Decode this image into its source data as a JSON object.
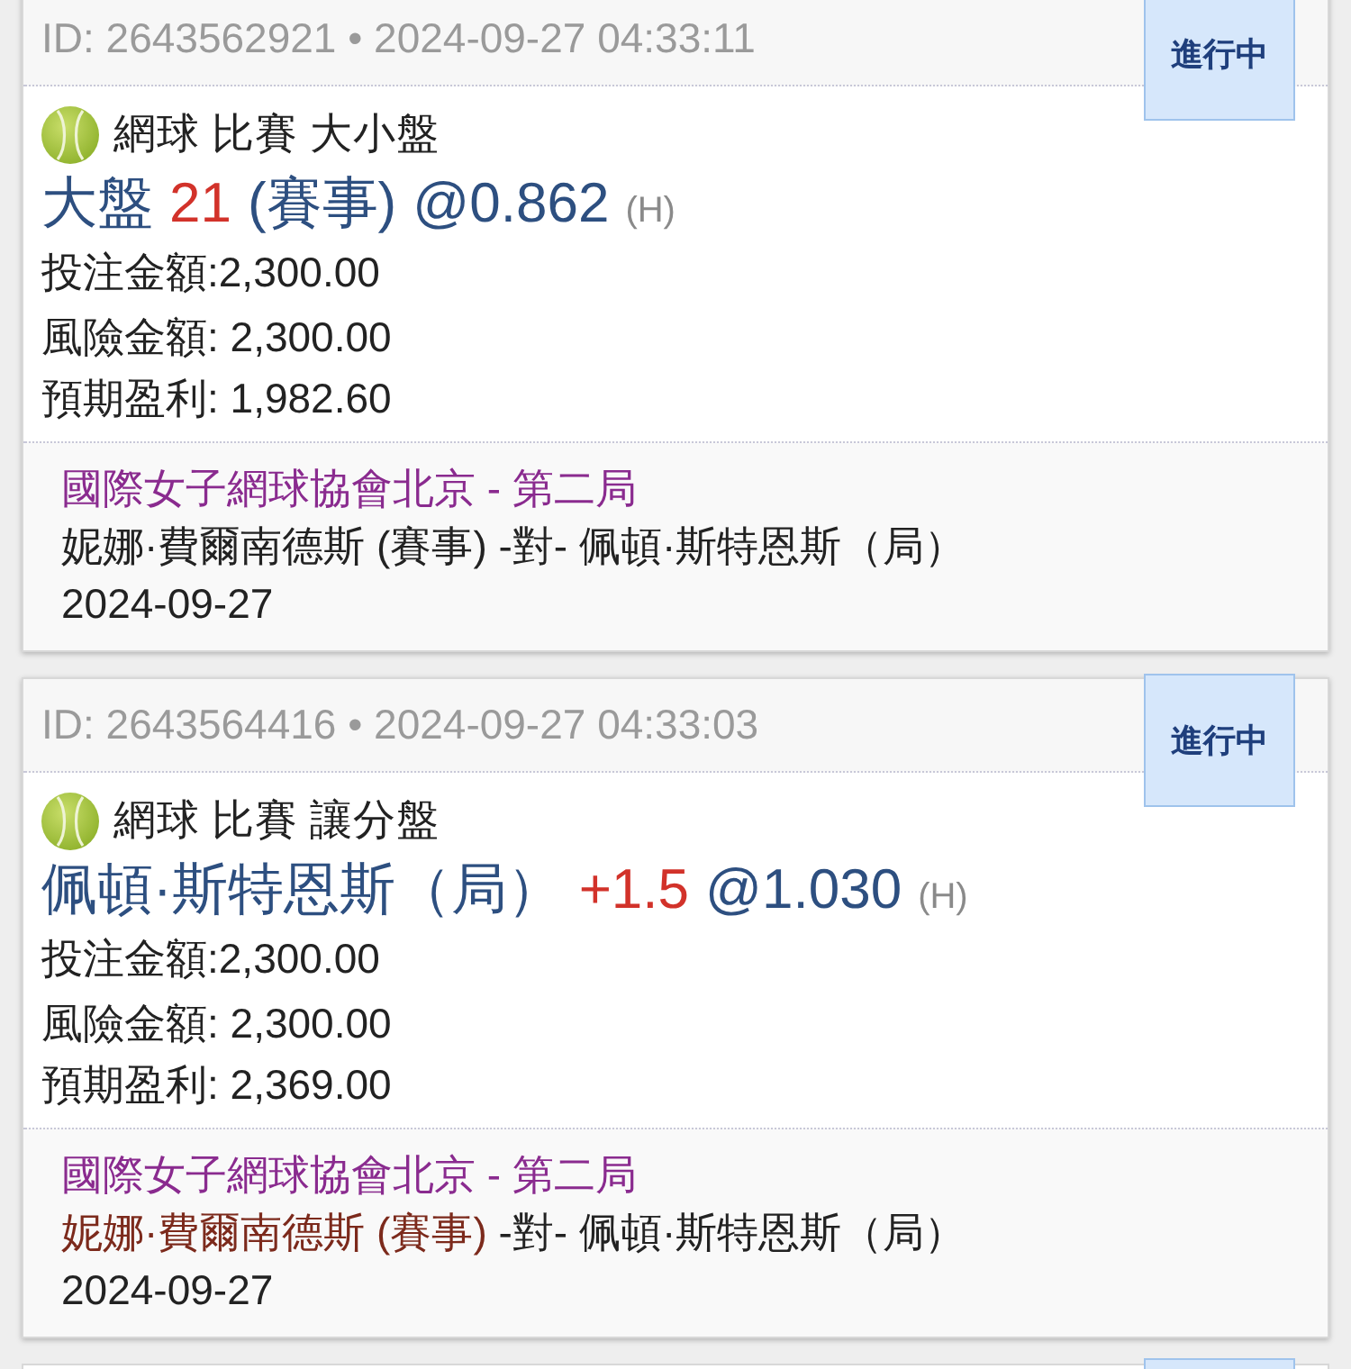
{
  "bets": [
    {
      "id_line": "ID: 2643562921 • 2024-09-27 04:33:11",
      "status": "進行中",
      "market": "網球 比賽 大小盤",
      "selection": [
        {
          "kind": "label",
          "text": "大盤"
        },
        {
          "kind": "handicap",
          "text": "21"
        },
        {
          "kind": "label",
          "text": "(賽事)"
        },
        {
          "kind": "odds",
          "text": "@0.862"
        },
        {
          "kind": "odds_format",
          "text": "(H)"
        }
      ],
      "amounts": [
        "投注金額:2,300.00",
        "風險金額: 2,300.00",
        "預期盈利: 1,982.60"
      ],
      "league": "國際女子網球協會北京 - 第二局",
      "teams": [
        {
          "name": "妮娜·費爾南德斯 (賽事)",
          "selected": false
        },
        {
          "name": "佩頓·斯特恩斯（局）",
          "selected": false
        }
      ],
      "versus": "-對-",
      "match_date": "2024-09-27"
    },
    {
      "id_line": "ID: 2643564416 • 2024-09-27 04:33:03",
      "status": "進行中",
      "market": "網球 比賽 讓分盤",
      "selection": [
        {
          "kind": "label",
          "text": "佩頓·斯特恩斯（局）"
        },
        {
          "kind": "handicap",
          "text": "+1.5"
        },
        {
          "kind": "odds",
          "text": "@1.030"
        },
        {
          "kind": "odds_format",
          "text": "(H)"
        }
      ],
      "amounts": [
        "投注金額:2,300.00",
        "風險金額: 2,300.00",
        "預期盈利: 2,369.00"
      ],
      "league": "國際女子網球協會北京 - 第二局",
      "teams": [
        {
          "name": "妮娜·費爾南德斯 (賽事)",
          "selected": true
        },
        {
          "name": "佩頓·斯特恩斯（局）",
          "selected": false
        }
      ],
      "versus": "-對-",
      "match_date": "2024-09-27"
    }
  ],
  "more_below": true
}
